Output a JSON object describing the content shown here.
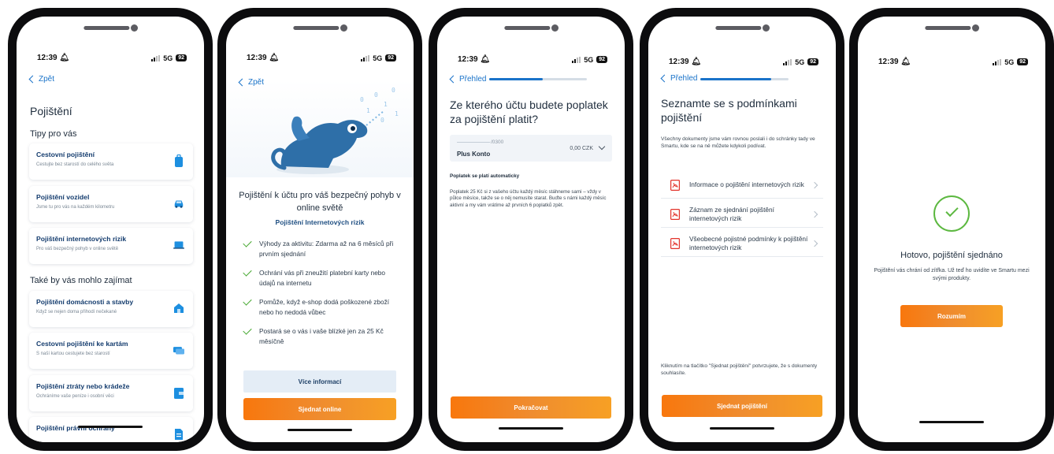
{
  "status_bar": {
    "time": "12:39",
    "network": "5G",
    "battery": "92"
  },
  "screen1": {
    "back_label": "Zpět",
    "title": "Pojištění",
    "section1": "Tipy pro vás",
    "section2": "Také by vás mohlo zajímat",
    "cards": [
      {
        "title": "Cestovní pojištění",
        "subtitle": "Cestujte bez starostí do celého světa",
        "icon": "suitcase-icon"
      },
      {
        "title": "Pojištění vozidel",
        "subtitle": "Jsme tu pro vás na každém kilometru",
        "icon": "car-icon"
      },
      {
        "title": "Pojištění internetových rizik",
        "subtitle": "Pro váš bezpečný pohyb v online světě",
        "icon": "laptop-icon"
      },
      {
        "title": "Pojištění domácnosti a stavby",
        "subtitle": "Když se nejen doma přihodí nečekané",
        "icon": "house-icon"
      },
      {
        "title": "Cestovní pojištění ke kartám",
        "subtitle": "S naší kartou cestujete bez starostí",
        "icon": "cards-icon"
      },
      {
        "title": "Pojištění ztráty nebo krádeže",
        "subtitle": "Ochráníme vaše peníze i osobní věci",
        "icon": "wallet-icon"
      },
      {
        "title": "Pojištění právní ochrany",
        "subtitle": "",
        "icon": "document-icon"
      }
    ]
  },
  "screen2": {
    "back_label": "Zpět",
    "headline": "Pojištění k účtu pro váš bezpečný pohyb v online světě",
    "product": "Pojištění Internetových rizik",
    "bullets": [
      "Výhody za aktivitu: Zdarma až na 6 měsíců při prvním sjednání",
      "Ochrání vás při zneužití platební karty nebo údajů na internetu",
      "Pomůže, když e-shop dodá poškozené zboží nebo ho nedodá vůbec",
      "Postará se o vás i vaše blízké jen za 25 Kč měsíčně"
    ],
    "more_button": "Více informací",
    "order_button": "Sjednat online"
  },
  "screen3": {
    "back_label": "Přehled",
    "progress": 0.55,
    "title": "Ze kterého účtu budete poplatek za pojištění platit?",
    "account": {
      "number_suffix": "/0300",
      "name": "Plus Konto",
      "balance": "0,00 CZK"
    },
    "auto_label": "Poplatek se platí automaticky",
    "auto_text": "Poplatek 25 Kč si z vašeho účtu každý měsíc stáhneme sami – vždy v půlce měsíce, takže se o něj nemusíte starat. Buďte s námi každý měsíc aktivní a my vám vrátíme až prvních 6 poplatků zpět.",
    "continue_button": "Pokračovat"
  },
  "screen4": {
    "back_label": "Přehled",
    "progress": 0.8,
    "title": "Seznamte se s podmínkami pojištění",
    "intro": "Všechny dokumenty jsme vám rovnou poslali i do schránky tady ve Smartu, kde se na ně můžete kdykoli podívat.",
    "documents": [
      "Informace o pojištění internetových rizik",
      "Záznam ze sjednání pojištění internetových rizik",
      "Všeobecné pojistné podmínky k pojištění internetových rizik"
    ],
    "consent": "Kliknutím na tlačítko \"Sjednat pojištění\" potvrzujete, že s dokumenty souhlasíte.",
    "confirm_button": "Sjednat pojištění"
  },
  "screen5": {
    "title": "Hotovo, pojištění sjednáno",
    "text": "Pojištění vás chrání od zítřka. Už teď ho uvidíte ve Smartu mezi svými produkty.",
    "ok_button": "Rozumím"
  }
}
